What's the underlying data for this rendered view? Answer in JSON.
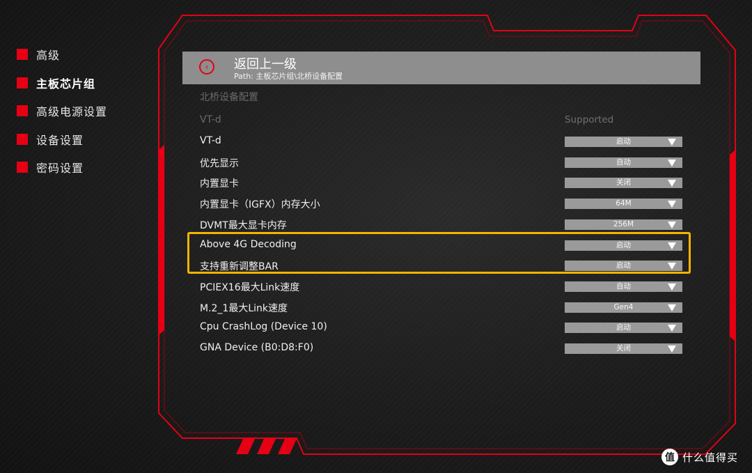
{
  "sidebar": {
    "items": [
      {
        "label": "高级"
      },
      {
        "label": "主板芯片组"
      },
      {
        "label": "高级电源设置"
      },
      {
        "label": "设备设置"
      },
      {
        "label": "密码设置"
      }
    ]
  },
  "header": {
    "back_icon": "back-arrow-icon",
    "title": "返回上一级",
    "path": "Path: 主板芯片组\\北桥设备配置"
  },
  "section_title": "北桥设备配置",
  "info": {
    "label": "VT-d",
    "value": "Supported"
  },
  "settings": [
    {
      "label": "VT-d",
      "value": "启动"
    },
    {
      "label": "优先显示",
      "value": "自动"
    },
    {
      "label": "内置显卡",
      "value": "关闭"
    },
    {
      "label": "内置显卡（IGFX）内存大小",
      "value": "64M"
    },
    {
      "label": "DVMT最大显卡内存",
      "value": "256M"
    },
    {
      "label": "Above 4G Decoding",
      "value": "启动"
    },
    {
      "label": "支持重新调整BAR",
      "value": "启动"
    },
    {
      "label": "PCIEX16最大Link速度",
      "value": "自动"
    },
    {
      "label": "M.2_1最大Link速度",
      "value": "Gen4"
    },
    {
      "label": "Cpu CrashLog (Device 10)",
      "value": "启动"
    },
    {
      "label": "GNA Device (B0:D8:F0)",
      "value": "关闭"
    }
  ],
  "watermark": {
    "logo": "值",
    "text": "什么值得买"
  },
  "colors": {
    "accent": "#e50014",
    "highlight": "#f5b400",
    "header_bg": "#8e8e8e",
    "dropdown_bg": "#9a9a9a"
  }
}
